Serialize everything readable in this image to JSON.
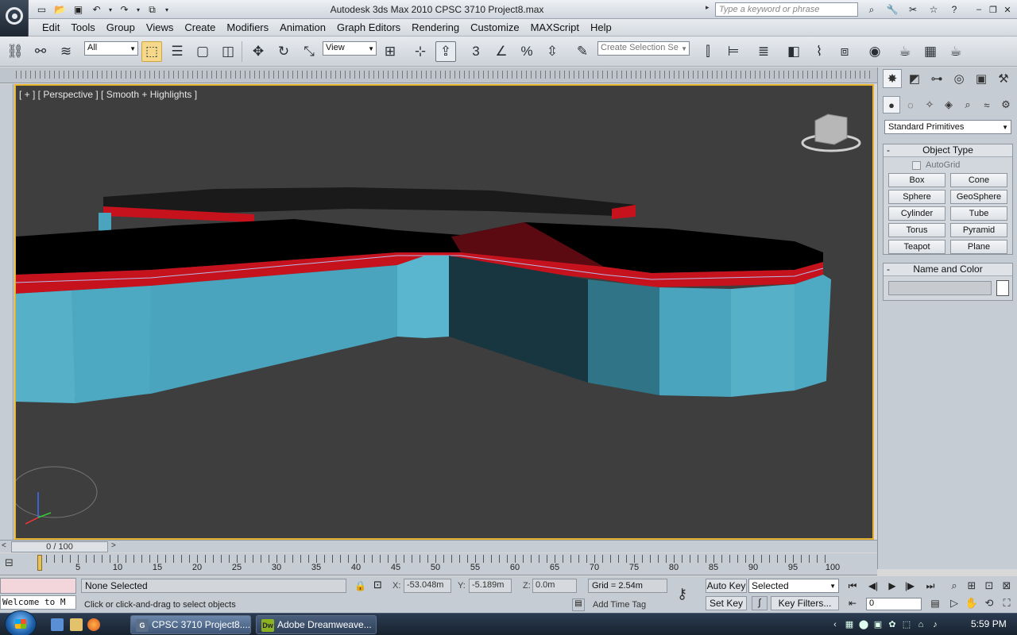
{
  "window": {
    "title": "Autodesk 3ds Max  2010      CPSC 3710 Project8.max",
    "search_placeholder": "Type a keyword or phrase"
  },
  "menu": [
    "Edit",
    "Tools",
    "Group",
    "Views",
    "Create",
    "Modifiers",
    "Animation",
    "Graph Editors",
    "Rendering",
    "Customize",
    "MAXScript",
    "Help"
  ],
  "toolbar": {
    "filter_value": "All",
    "refcoord_value": "View",
    "selection_set_placeholder": "Create Selection Se"
  },
  "viewport": {
    "label": "[ + ] [ Perspective ] [ Smooth + Highlights ]",
    "background_color": "#3e3e3e",
    "active_border_color": "#e6b32e",
    "object_top_color": "#000000",
    "object_band_color": "#c5121d",
    "object_side_color": "#4aa4bd"
  },
  "command_panel": {
    "category": "Standard Primitives",
    "object_type_title": "Object Type",
    "autogrid_label": "AutoGrid",
    "primitives": [
      "Box",
      "Cone",
      "Sphere",
      "GeoSphere",
      "Cylinder",
      "Tube",
      "Torus",
      "Pyramid",
      "Teapot",
      "Plane"
    ],
    "name_color_title": "Name and Color",
    "rollout_toggle": "-"
  },
  "timeline": {
    "frame_display": "0 / 100",
    "ticks": [
      "5",
      "10",
      "15",
      "20",
      "25",
      "30",
      "35",
      "40",
      "45",
      "50",
      "55",
      "60",
      "65",
      "70",
      "75",
      "80",
      "85",
      "90",
      "95",
      "100"
    ]
  },
  "status": {
    "selection": "None Selected",
    "prompt": "Click or click-and-drag to select objects",
    "listener_text": "Welcome to M",
    "x_label": "X:",
    "x_value": "-53.048m",
    "y_label": "Y:",
    "y_value": "-5.189m",
    "z_label": "Z:",
    "z_value": "0.0m",
    "grid": "Grid = 2.54m",
    "add_time_tag": "Add Time Tag",
    "auto_key": "Auto Key",
    "set_key": "Set Key",
    "key_mode_value": "Selected",
    "key_filters": "Key Filters...",
    "current_frame": "0"
  },
  "taskbar": {
    "items": [
      {
        "label": "CPSC 3710 Project8....",
        "icon_text": "G"
      },
      {
        "label": "Adobe Dreamweave...",
        "icon_text": "Dw"
      }
    ],
    "clock": "5:59 PM"
  }
}
